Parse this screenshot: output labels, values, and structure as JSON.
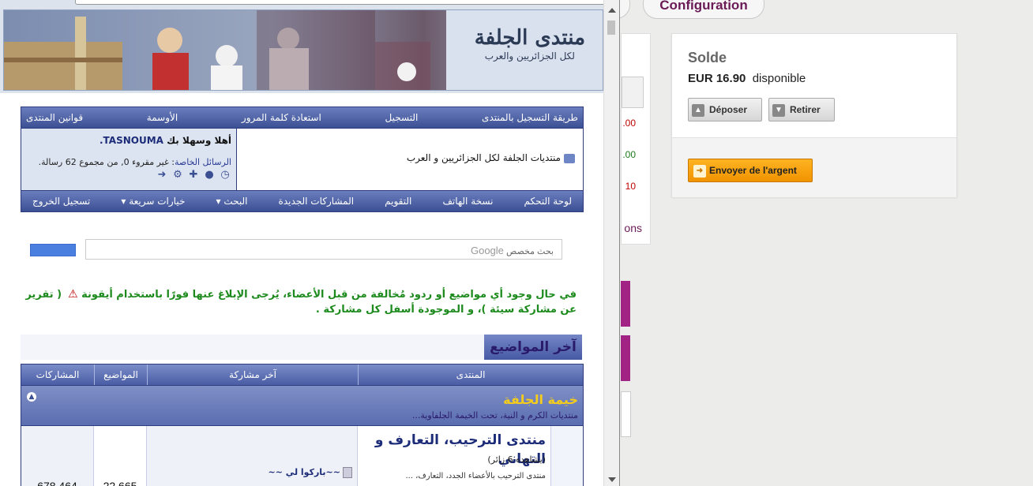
{
  "background": {
    "config_button": "Configuration",
    "left_card": {
      "amounts": [
        ".00",
        ".00",
        "10"
      ],
      "amount_colors": [
        "#c00000",
        "#1c7a1c",
        "#c00000"
      ],
      "suffix": "ons"
    },
    "balance": {
      "title": "Solde",
      "currency_amount": "EUR 16.90",
      "status": "disponible",
      "deposit_label": "Déposer",
      "withdraw_label": "Retirer",
      "send_label": "Envoyer de l'argent"
    },
    "accent_color": "#a12384"
  },
  "forum": {
    "banner": {
      "logo_main": "منتدى الجلفة",
      "logo_sub": "لكل الجزائريين والعرب"
    },
    "nav_top": [
      "طريقة التسجيل بالمنتدى",
      "التسجيل",
      "استعادة كلمة المرور",
      "الأوسمة",
      "قوانين المنتدى"
    ],
    "forum_name": "منتديات الجلفة لكل الجزائريين و العرب",
    "user": {
      "welcome_prefix": "أهلا وسهلا بك",
      "username": "TASNOUMA.",
      "msgs_link": "الرسائل الخاصة",
      "msgs_text": ": غير مقروء 0, من مجموع 62 رسالة."
    },
    "nav_bottom": [
      "لوحة التحكم",
      "نسخة الهاتف",
      "التقويم",
      "المشاركات الجديدة",
      "البحث",
      "خيارات سريعة",
      "تسجيل الخروج"
    ],
    "search": {
      "brand": "Google",
      "placeholder": "بحث مخصص"
    },
    "notice": {
      "part1": "في حال وجود أي مواضيع أو ردود مُخالفة من قبل الأعضاء، يُرجى الإبلاغ عنها فورًا باستخدام أيقونة",
      "part2": "( تقرير عن مشاركة سيئة )، و الموجودة أسفل كل مشاركة ."
    },
    "latest_title": "آخر المواضيع",
    "table": {
      "headers": {
        "forum": "المنتدى",
        "last_post": "آخر مشاركة",
        "topics": "المواضيع",
        "posts": "المشاركات"
      },
      "category": {
        "title": "خيمة الجلفة",
        "desc": "منتديات الكرم و النية، تحت الخيمة الجلفاوية..."
      },
      "row": {
        "name": "منتدى الترحيب، التعارف و التهاني",
        "viewers": "(يشاهده 6 زائر)",
        "desc": "منتدى الترحيب بالأعضاء الجدد، التعارف، ...",
        "last_post": "~~باركوا لي ~~",
        "topics": "22,665",
        "posts": "678,464"
      }
    }
  }
}
